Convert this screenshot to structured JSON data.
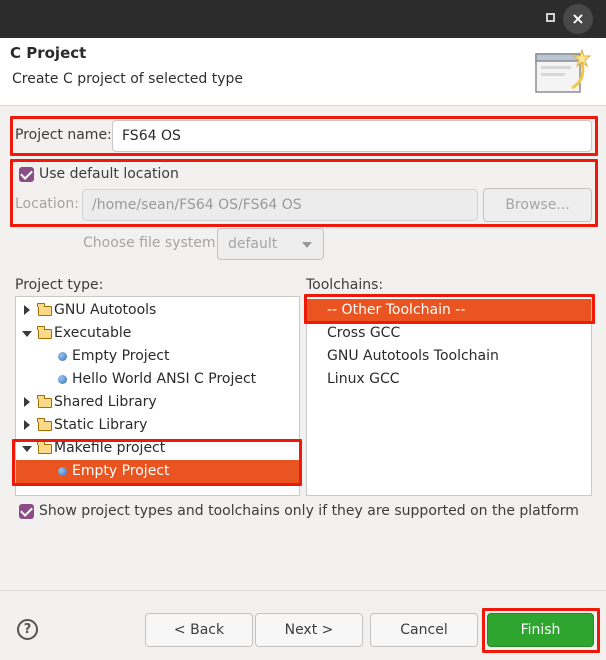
{
  "window": {
    "close_glyph": "×"
  },
  "header": {
    "title": "C Project",
    "subtitle": "Create C project of selected type"
  },
  "project_name": {
    "label": "Project name:",
    "value": "FS64 OS"
  },
  "location": {
    "use_default_label": "Use default location",
    "use_default_checked": true,
    "label": "Location:",
    "value": "/home/sean/FS64 OS/FS64 OS",
    "browse_label": "Browse..."
  },
  "file_system": {
    "label": "Choose file system:",
    "value": "default"
  },
  "project_type": {
    "label": "Project type:",
    "items": [
      {
        "label": "GNU Autotools",
        "kind": "folder",
        "expanded": false,
        "level": 0
      },
      {
        "label": "Executable",
        "kind": "folder",
        "expanded": true,
        "level": 0
      },
      {
        "label": "Empty Project",
        "kind": "leaf",
        "level": 1
      },
      {
        "label": "Hello World ANSI C Project",
        "kind": "leaf",
        "level": 1
      },
      {
        "label": "Shared Library",
        "kind": "folder",
        "expanded": false,
        "level": 0
      },
      {
        "label": "Static Library",
        "kind": "folder",
        "expanded": false,
        "level": 0
      },
      {
        "label": "Makefile project",
        "kind": "folder",
        "expanded": true,
        "level": 0
      },
      {
        "label": "Empty Project",
        "kind": "leaf",
        "level": 1,
        "selected": true
      }
    ]
  },
  "toolchains": {
    "label": "Toolchains:",
    "items": [
      {
        "label": "-- Other Toolchain --",
        "selected": true
      },
      {
        "label": "Cross GCC"
      },
      {
        "label": "GNU Autotools Toolchain"
      },
      {
        "label": "Linux GCC"
      }
    ]
  },
  "supported_only": {
    "label": "Show project types and toolchains only if they are supported on the platform",
    "checked": true
  },
  "footer": {
    "help_glyph": "?",
    "back_label": "< Back",
    "next_label": "Next >",
    "cancel_label": "Cancel",
    "finish_label": "Finish"
  },
  "colors": {
    "accent": "#e95420",
    "checkbox": "#8a4d88",
    "highlight_box": "#f01808",
    "finish": "#2ea52e"
  }
}
